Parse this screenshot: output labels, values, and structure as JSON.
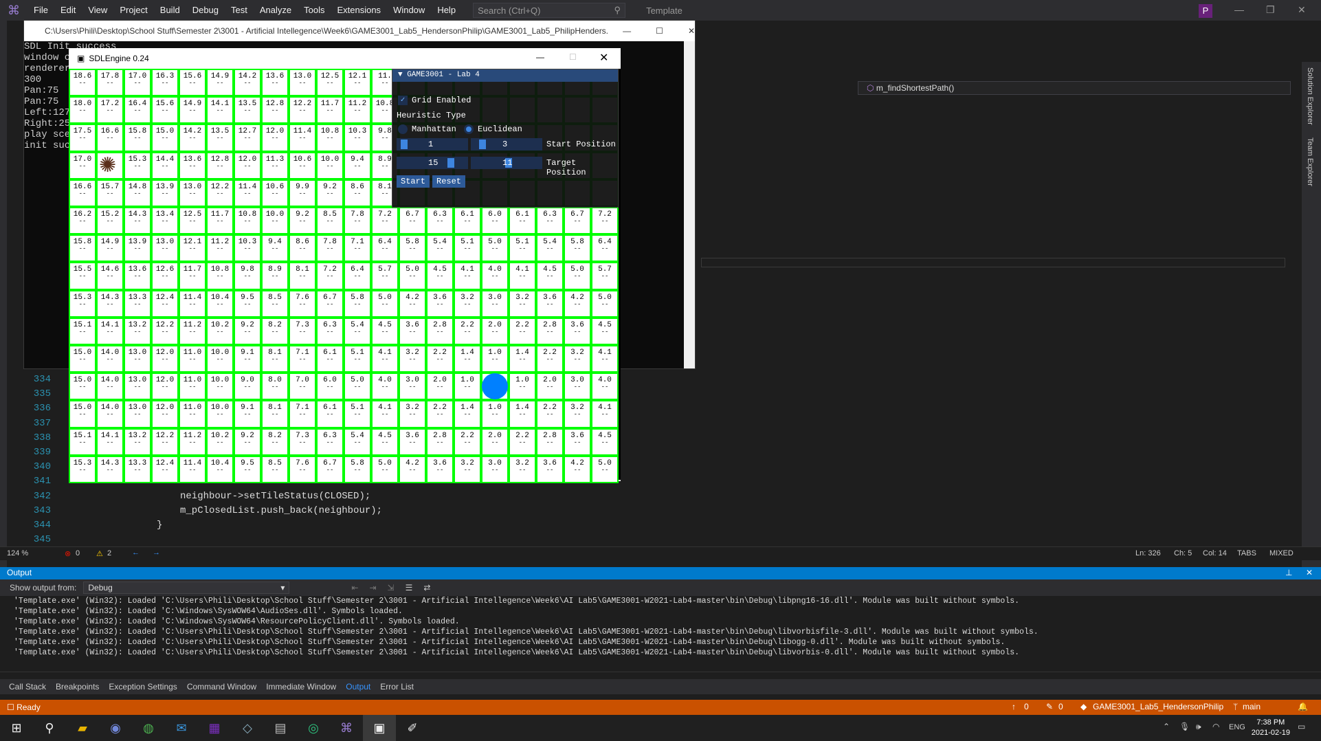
{
  "menubar": {
    "items": [
      "File",
      "Edit",
      "View",
      "Project",
      "Build",
      "Debug",
      "Test",
      "Analyze",
      "Tools",
      "Extensions",
      "Window",
      "Help"
    ],
    "search_placeholder": "Search (Ctrl+Q)",
    "solution": "Template",
    "profile_initial": "P"
  },
  "editor": {
    "nav_function": "m_findShortestPath()",
    "lines": [
      {
        "no": "334",
        "code": ""
      },
      {
        "no": "335",
        "code": ""
      },
      {
        "no": "336",
        "code": ""
      },
      {
        "no": "337",
        "code": ""
      },
      {
        "no": "338",
        "code": ""
      },
      {
        "no": "339",
        "code": ""
      },
      {
        "no": "340",
        "code": ""
      },
      {
        "no": "341",
        "code": ""
      },
      {
        "no": "342",
        "code": "neighbour->setTileStatus(CLOSED);"
      },
      {
        "no": "343",
        "code": "m_pClosedList.push_back(neighbour);"
      },
      {
        "no": "344",
        "code": "}"
      },
      {
        "no": "345",
        "code": ""
      }
    ],
    "status": {
      "zoom": "124 %",
      "errors": "0",
      "warnings": "2",
      "ln": "Ln: 326",
      "ch": "Ch: 5",
      "col": "Col: 14",
      "tabs": "TABS",
      "mixed": "MIXED"
    }
  },
  "side_tabs": [
    "Solution Explorer",
    "Team Explorer"
  ],
  "console": {
    "title": "C:\\Users\\Phili\\Desktop\\School Stuff\\Semester 2\\3001 - Artificial Intellegence\\Week6\\GAME3001_Lab5_HendersonPhilip\\GAME3001_Lab5_PhilipHenders...",
    "lines": [
      "SDL Init success",
      "window c",
      "renderer",
      "300",
      "Pan:75",
      "Pan:75",
      "Left:127",
      "Right:25",
      "play sce",
      "init suc"
    ]
  },
  "sdl": {
    "title": "SDLEngine 0.24",
    "grid": [
      [
        "18.6",
        "17.8",
        "17.0",
        "16.3",
        "15.6",
        "14.9",
        "14.2",
        "13.6",
        "13.0",
        "12.5",
        "12.1",
        "11.",
        "",
        "",
        "",
        "",
        "",
        "",
        "",
        ""
      ],
      [
        "18.0",
        "17.2",
        "16.4",
        "15.6",
        "14.9",
        "14.1",
        "13.5",
        "12.8",
        "12.2",
        "11.7",
        "11.2",
        "10.8",
        "",
        "",
        "",
        "",
        "",
        "",
        "",
        ""
      ],
      [
        "17.5",
        "16.6",
        "15.8",
        "15.0",
        "14.2",
        "13.5",
        "12.7",
        "12.0",
        "11.4",
        "10.8",
        "10.3",
        "9.8",
        "",
        "",
        "",
        "",
        "",
        "",
        "",
        ""
      ],
      [
        "17.0",
        "",
        "15.3",
        "14.4",
        "13.6",
        "12.8",
        "12.0",
        "11.3",
        "10.6",
        "10.0",
        "9.4",
        "8.9",
        "",
        "",
        "",
        "",
        "",
        "",
        "",
        ""
      ],
      [
        "16.6",
        "15.7",
        "14.8",
        "13.9",
        "13.0",
        "12.2",
        "11.4",
        "10.6",
        "9.9",
        "9.2",
        "8.6",
        "8.1",
        "",
        "",
        "",
        "",
        "",
        "",
        "",
        ""
      ],
      [
        "16.2",
        "15.2",
        "14.3",
        "13.4",
        "12.5",
        "11.7",
        "10.8",
        "10.0",
        "9.2",
        "8.5",
        "7.8",
        "7.2",
        "6.7",
        "6.3",
        "6.1",
        "6.0",
        "6.1",
        "6.3",
        "6.7",
        "7.2"
      ],
      [
        "15.8",
        "14.9",
        "13.9",
        "13.0",
        "12.1",
        "11.2",
        "10.3",
        "9.4",
        "8.6",
        "7.8",
        "7.1",
        "6.4",
        "5.8",
        "5.4",
        "5.1",
        "5.0",
        "5.1",
        "5.4",
        "5.8",
        "6.4"
      ],
      [
        "15.5",
        "14.6",
        "13.6",
        "12.6",
        "11.7",
        "10.8",
        "9.8",
        "8.9",
        "8.1",
        "7.2",
        "6.4",
        "5.7",
        "5.0",
        "4.5",
        "4.1",
        "4.0",
        "4.1",
        "4.5",
        "5.0",
        "5.7"
      ],
      [
        "15.3",
        "14.3",
        "13.3",
        "12.4",
        "11.4",
        "10.4",
        "9.5",
        "8.5",
        "7.6",
        "6.7",
        "5.8",
        "5.0",
        "4.2",
        "3.6",
        "3.2",
        "3.0",
        "3.2",
        "3.6",
        "4.2",
        "5.0"
      ],
      [
        "15.1",
        "14.1",
        "13.2",
        "12.2",
        "11.2",
        "10.2",
        "9.2",
        "8.2",
        "7.3",
        "6.3",
        "5.4",
        "4.5",
        "3.6",
        "2.8",
        "2.2",
        "2.0",
        "2.2",
        "2.8",
        "3.6",
        "4.5"
      ],
      [
        "15.0",
        "14.0",
        "13.0",
        "12.0",
        "11.0",
        "10.0",
        "9.1",
        "8.1",
        "7.1",
        "6.1",
        "5.1",
        "4.1",
        "3.2",
        "2.2",
        "1.4",
        "1.0",
        "1.4",
        "2.2",
        "3.2",
        "4.1"
      ],
      [
        "15.0",
        "14.0",
        "13.0",
        "12.0",
        "11.0",
        "10.0",
        "9.0",
        "8.0",
        "7.0",
        "6.0",
        "5.0",
        "4.0",
        "3.0",
        "2.0",
        "1.0",
        "",
        "1.0",
        "2.0",
        "3.0",
        "4.0"
      ],
      [
        "15.0",
        "14.0",
        "13.0",
        "12.0",
        "11.0",
        "10.0",
        "9.1",
        "8.1",
        "7.1",
        "6.1",
        "5.1",
        "4.1",
        "3.2",
        "2.2",
        "1.4",
        "1.0",
        "1.4",
        "2.2",
        "3.2",
        "4.1"
      ],
      [
        "15.1",
        "14.1",
        "13.2",
        "12.2",
        "11.2",
        "10.2",
        "9.2",
        "8.2",
        "7.3",
        "6.3",
        "5.4",
        "4.5",
        "3.6",
        "2.8",
        "2.2",
        "2.0",
        "2.2",
        "2.8",
        "3.6",
        "4.5"
      ],
      [
        "15.3",
        "14.3",
        "13.3",
        "12.4",
        "11.4",
        "10.4",
        "9.5",
        "8.5",
        "7.6",
        "6.7",
        "5.8",
        "5.0",
        "4.2",
        "3.6",
        "3.2",
        "3.0",
        "3.2",
        "3.6",
        "4.2",
        "5.0"
      ]
    ],
    "cell_status": "--",
    "start_cell": {
      "col": 1,
      "row": 3
    },
    "target_cell": {
      "col": 15,
      "row": 11
    }
  },
  "imgui": {
    "title": "GAME3001 - Lab 4",
    "grid_enabled_label": "Grid Enabled",
    "heuristic_label": "Heuristic Type",
    "manhattan_label": "Manhattan",
    "euclidean_label": "Euclidean",
    "start_x": "1",
    "start_y": "3",
    "start_label": "Start Position",
    "target_x": "15",
    "target_y": "11",
    "target_label": "Target Position",
    "start_button": "Start",
    "reset_button": "Reset"
  },
  "output": {
    "header": "Output",
    "show_from_label": "Show output from:",
    "source": "Debug",
    "lines": [
      "'Template.exe' (Win32): Loaded 'C:\\Users\\Phili\\Desktop\\School Stuff\\Semester 2\\3001 - Artificial Intellegence\\Week6\\AI Lab5\\GAME3001-W2021-Lab4-master\\bin\\Debug\\libpng16-16.dll'. Module was built without symbols.",
      "'Template.exe' (Win32): Loaded 'C:\\Windows\\SysWOW64\\AudioSes.dll'. Symbols loaded.",
      "'Template.exe' (Win32): Loaded 'C:\\Windows\\SysWOW64\\ResourcePolicyClient.dll'. Symbols loaded.",
      "'Template.exe' (Win32): Loaded 'C:\\Users\\Phili\\Desktop\\School Stuff\\Semester 2\\3001 - Artificial Intellegence\\Week6\\AI Lab5\\GAME3001-W2021-Lab4-master\\bin\\Debug\\libvorbisfile-3.dll'. Module was built without symbols.",
      "'Template.exe' (Win32): Loaded 'C:\\Users\\Phili\\Desktop\\School Stuff\\Semester 2\\3001 - Artificial Intellegence\\Week6\\AI Lab5\\GAME3001-W2021-Lab4-master\\bin\\Debug\\libogg-0.dll'. Module was built without symbols.",
      "'Template.exe' (Win32): Loaded 'C:\\Users\\Phili\\Desktop\\School Stuff\\Semester 2\\3001 - Artificial Intellegence\\Week6\\AI Lab5\\GAME3001-W2021-Lab4-master\\bin\\Debug\\libvorbis-0.dll'. Module was built without symbols."
    ]
  },
  "bottom_tabs": [
    "Call Stack",
    "Breakpoints",
    "Exception Settings",
    "Command Window",
    "Immediate Window",
    "Output",
    "Error List"
  ],
  "active_bottom_tab": "Output",
  "statusbar": {
    "ready": "Ready",
    "up": "0",
    "edits": "0",
    "repo": "GAME3001_Lab5_HendersonPhilip",
    "branch": "main"
  },
  "taskbar": {
    "time": "7:38 PM",
    "date": "2021-02-19",
    "lang": "ENG"
  },
  "colors": {
    "vs_accent": "#007acc",
    "status_orange": "#ca5100",
    "grid_line": "#00ff00",
    "agent_blue": "#0080ff"
  }
}
